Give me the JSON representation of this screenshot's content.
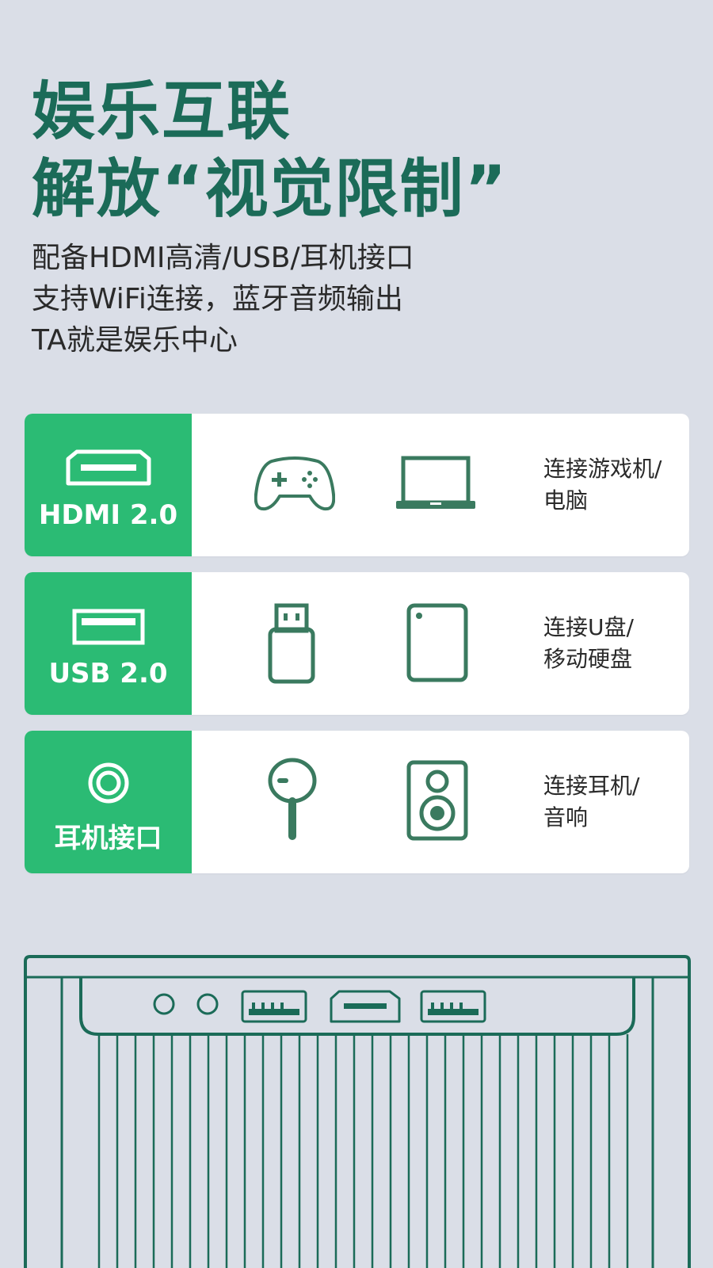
{
  "headline": {
    "line1": "娱乐互联",
    "line2": "解放“视觉限制”"
  },
  "subtitle": {
    "line1": "配备HDMI高清/USB/耳机接口",
    "line2": "支持WiFi连接，蓝牙音频输出",
    "line3": "TA就是娱乐中心"
  },
  "colors": {
    "background": "#dadee7",
    "accent_green": "#2bbb74",
    "dark_green": "#1b6b58",
    "icon_green": "#3a7a5f"
  },
  "features": [
    {
      "label": "HDMI 2.0",
      "port_icon": "hdmi-port-icon",
      "device_icons": [
        "gamepad-icon",
        "laptop-icon"
      ],
      "desc_line1": "连接游戏机/",
      "desc_line2": "电脑"
    },
    {
      "label": "USB 2.0",
      "port_icon": "usb-port-icon",
      "device_icons": [
        "usb-drive-icon",
        "hard-drive-icon"
      ],
      "desc_line1": "连接U盘/",
      "desc_line2": "移动硬盘"
    },
    {
      "label": "耳机接口",
      "port_icon": "audio-jack-icon",
      "device_icons": [
        "earbud-icon",
        "speaker-icon"
      ],
      "desc_line1": "连接耳机/",
      "desc_line2": "音响"
    }
  ]
}
